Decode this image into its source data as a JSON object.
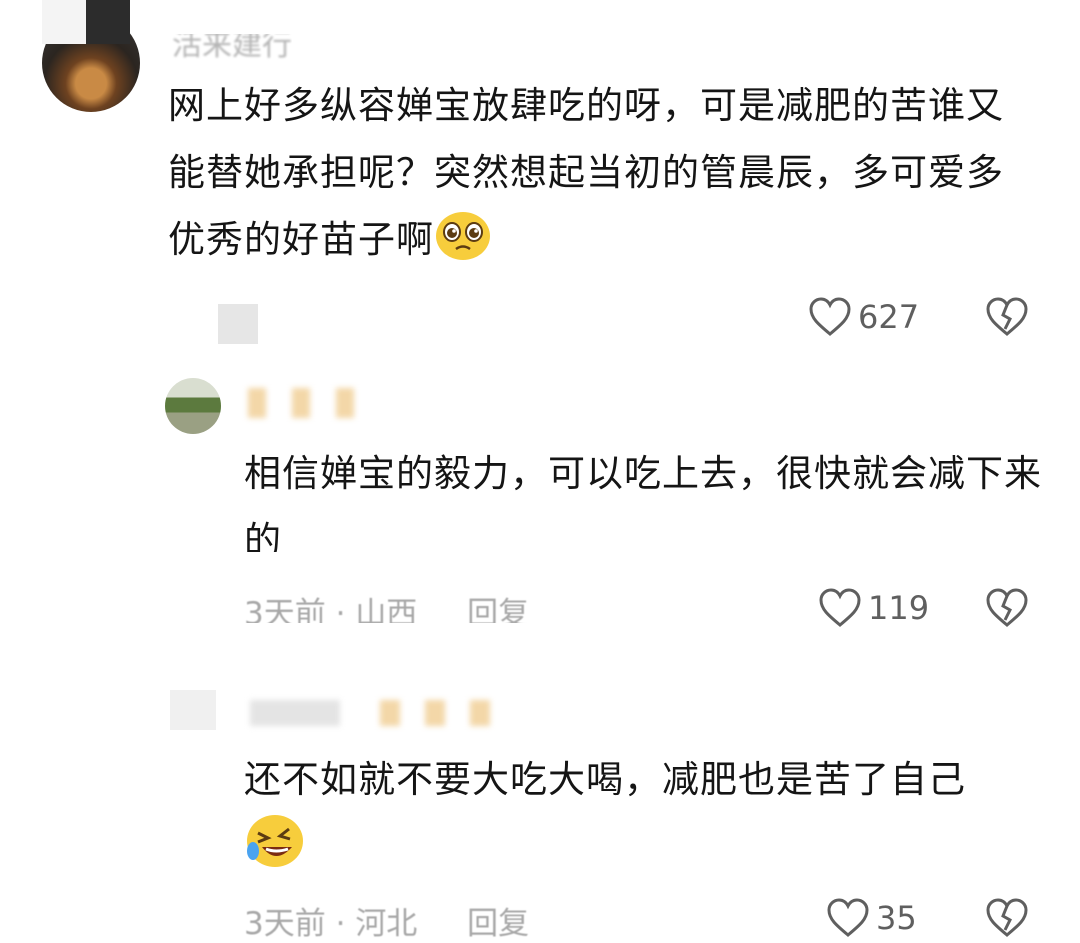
{
  "comments": [
    {
      "username": "活来建行",
      "text": "网上好多纵容婵宝放肆吃的呀，可是减肥的苦谁又能替她承担呢？突然想起当初的管晨辰，多可爱多优秀的好苗子啊",
      "emoji": "pleading-face",
      "likes": "627"
    },
    {
      "text": "相信婵宝的毅力，可以吃上去，很快就会减下来的",
      "time": "3天前",
      "location": "山西",
      "reply": "回复",
      "likes": "119"
    },
    {
      "text": "还不如就不要大吃大喝，减肥也是苦了自己",
      "emoji": "rolling-laughing-face",
      "time": "3天前",
      "location": "河北",
      "reply": "回复",
      "likes": "35"
    }
  ],
  "colors": {
    "text": "#151515",
    "meta": "#a8a8a8",
    "icon": "#5f5f5f"
  }
}
